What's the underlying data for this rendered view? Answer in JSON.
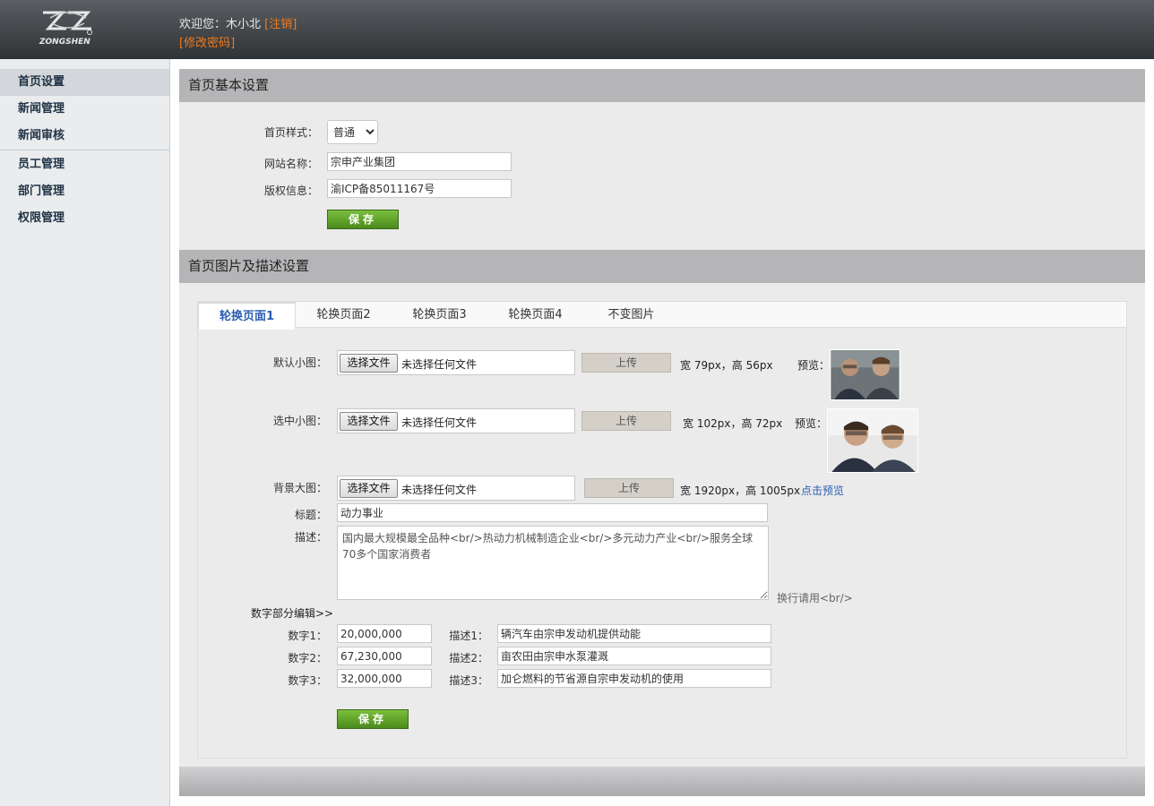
{
  "header": {
    "welcome_prefix": "欢迎您：木小北",
    "logout": "[注销]",
    "change_password": "[修改密码]"
  },
  "sidebar": {
    "items": [
      {
        "label": "首页设置"
      },
      {
        "label": "新闻管理"
      },
      {
        "label": "新闻审核"
      },
      {
        "label": "员工管理"
      },
      {
        "label": "部门管理"
      },
      {
        "label": "权限管理"
      }
    ]
  },
  "basic": {
    "title": "首页基本设置",
    "style_label": "首页样式：",
    "style_value": "普通",
    "site_name_label": "网站名称：",
    "site_name_value": "宗申产业集团",
    "copyright_label": "版权信息：",
    "copyright_value": "渝ICP备85011167号",
    "save": "保存"
  },
  "images": {
    "title": "首页图片及描述设置",
    "tabs": [
      {
        "label": "轮换页面1"
      },
      {
        "label": "轮换页面2"
      },
      {
        "label": "轮换页面3"
      },
      {
        "label": "轮换页面4"
      },
      {
        "label": "不变图片"
      }
    ],
    "choose_file": "选择文件",
    "no_file": "未选择任何文件",
    "upload": "上传",
    "preview_label": "预览：",
    "default_thumb": {
      "label": "默认小图：",
      "dims": "宽 79px，高 56px"
    },
    "selected_thumb": {
      "label": "选中小图：",
      "dims": "宽 102px，高 72px"
    },
    "background": {
      "label": "背景大图：",
      "dims": "宽 1920px，高 1005px",
      "preview_link": "点击预览"
    },
    "title_label": "标题：",
    "title_value": "动力事业",
    "desc_label": "描述：",
    "desc_value": "国内最大规模最全品种<br/>热动力机械制造企业<br/>多元动力产业<br/>服务全球70多个国家消费者",
    "linebreak_hint": "换行请用<br/>",
    "numbers_section": "数字部分编辑>>",
    "numbers": [
      {
        "num_label": "数字1：",
        "num_value": "20,000,000",
        "desc_label": "描述1：",
        "desc_value": "辆汽车由宗申发动机提供动能"
      },
      {
        "num_label": "数字2：",
        "num_value": "67,230,000",
        "desc_label": "描述2：",
        "desc_value": "亩农田由宗申水泵灌溉"
      },
      {
        "num_label": "数字3：",
        "num_value": "32,000,000",
        "desc_label": "描述3：",
        "desc_value": "加仑燃料的节省源自宗申发动机的使用"
      }
    ],
    "save": "保存"
  },
  "colors": {
    "accent_orange": "#f07a1e",
    "link_blue": "#2a5db0",
    "save_green": "#5a9a28"
  }
}
